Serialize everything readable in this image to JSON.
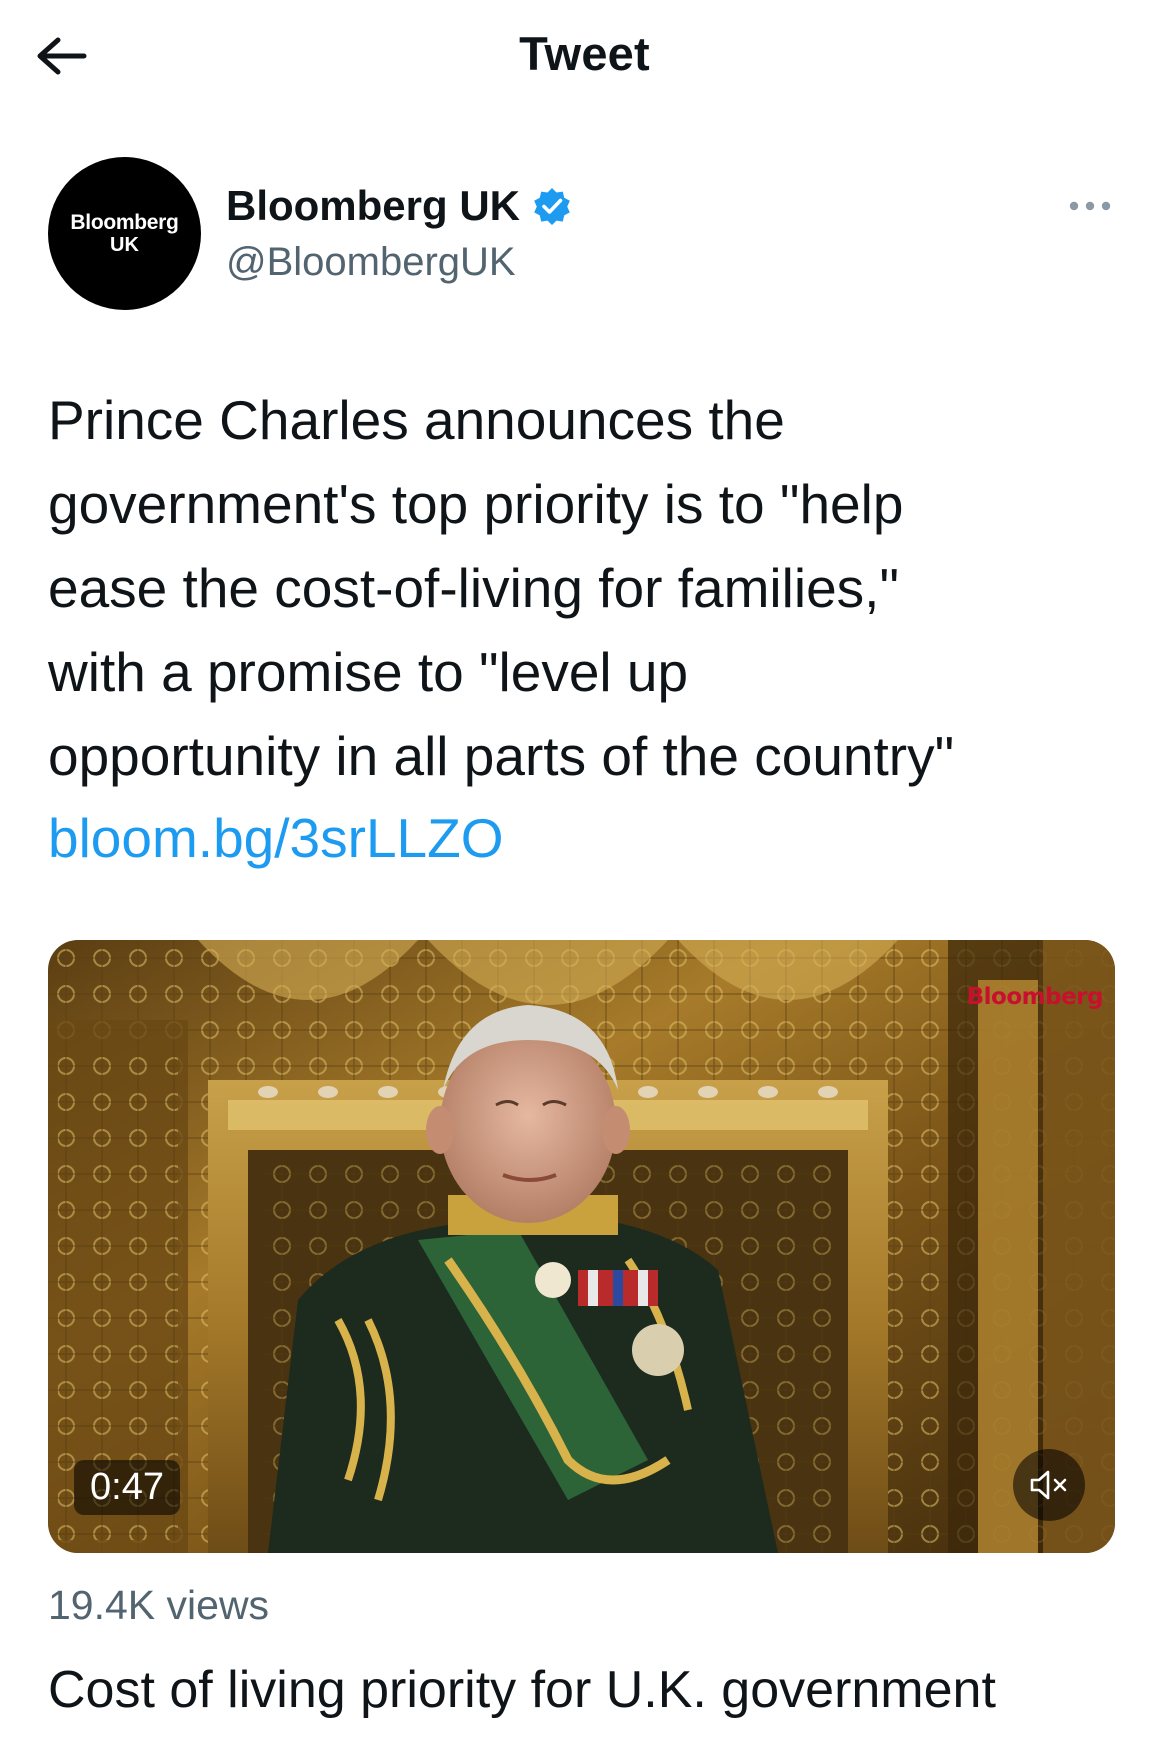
{
  "header": {
    "title": "Tweet",
    "back_icon": "arrow-left-icon"
  },
  "author": {
    "avatar_line1": "Bloomberg",
    "avatar_line2": "UK",
    "name": "Bloomberg UK",
    "handle": "@BloombergUK",
    "verified": true,
    "verified_color": "#1d9bf0"
  },
  "tweet": {
    "text": "Prince Charles announces the\ngovernment's top priority is to \"help\nease the cost-of-living for families,\"\nwith a promise to \"level up\nopportunity in all parts of the country\"",
    "link": "bloom.bg/3srLLZO",
    "link_color": "#1d9bf0"
  },
  "media": {
    "duration": "0:47",
    "watermark": "Bloomberg",
    "mute_icon": "speaker-muted-icon"
  },
  "stats": {
    "views": "19.4K views"
  },
  "card": {
    "title": "Cost of living priority for U.K. government"
  }
}
